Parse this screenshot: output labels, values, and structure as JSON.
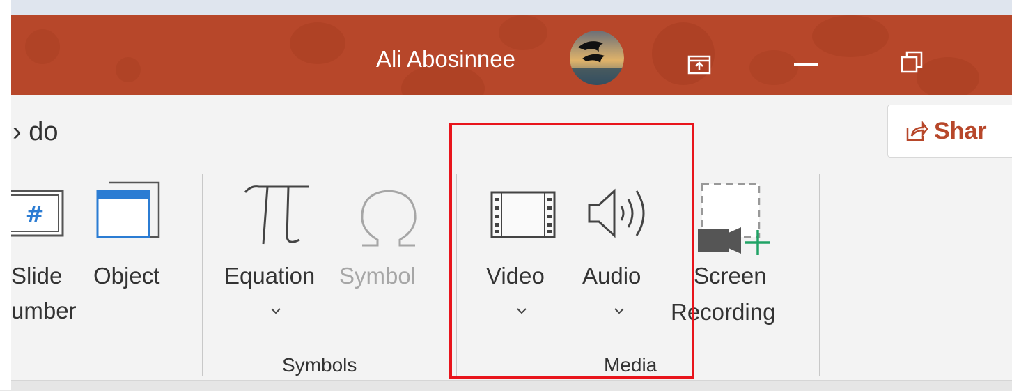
{
  "titlebar": {
    "user_name": "Ali Abosinnee",
    "background_color": "#b7472a",
    "buttons": [
      "ribbon-display-options-icon",
      "minimize-icon",
      "restore-icon"
    ]
  },
  "ribbon": {
    "tell_me_fragment": "› do",
    "share": {
      "label": "Shar",
      "icon": "share-icon",
      "color": "#b7472a"
    },
    "items": {
      "slide_number": {
        "line1": "Slide",
        "line2": "umber",
        "icon": "slide-number-icon"
      },
      "object": {
        "label": "Object",
        "icon": "object-icon"
      },
      "equation": {
        "label": "Equation",
        "icon": "pi-icon",
        "has_dropdown": true
      },
      "symbol": {
        "label": "Symbol",
        "icon": "omega-icon",
        "enabled": false
      },
      "video": {
        "label": "Video",
        "icon": "film-icon",
        "has_dropdown": true
      },
      "audio": {
        "label": "Audio",
        "icon": "speaker-icon",
        "has_dropdown": true
      },
      "screen_recording": {
        "line1": "Screen",
        "line2": "Recording",
        "icon": "screen-recording-icon"
      }
    },
    "groups": {
      "symbols": "Symbols",
      "media": "Media"
    }
  },
  "annotation": {
    "highlight_color": "#e8141b",
    "target": "Media"
  }
}
